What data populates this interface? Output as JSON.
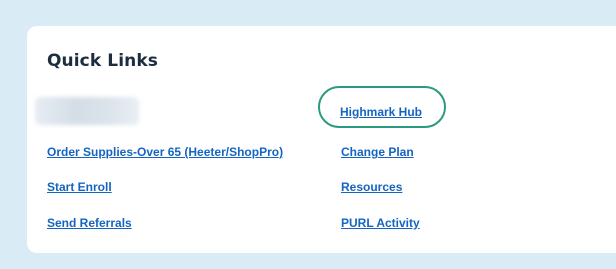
{
  "quick_links": {
    "title": "Quick Links",
    "left_column": [
      "Order Supplies-Over 65 (Heeter/ShopPro)",
      "Start Enroll",
      "Send Referrals"
    ],
    "right_column": [
      "Highmark Hub",
      "Change Plan",
      "Resources",
      "PURL Activity"
    ],
    "highlighted_link": "Highmark Hub",
    "highlight_color": "#2b9a7e",
    "link_color": "#1565c0",
    "background_color": "#d9ecf6"
  }
}
